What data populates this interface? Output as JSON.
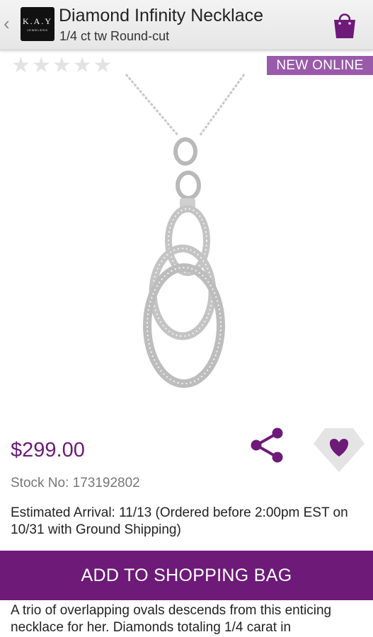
{
  "header": {
    "back_glyph": "‹",
    "logo": {
      "text": "K.A.Y",
      "subtext": "JEWELERS"
    },
    "title": "Diamond Infinity Necklace",
    "subtitle": "1/4 ct tw Round-cut",
    "bag_icon": "shopping-bag-icon"
  },
  "rating": {
    "stars_filled": 0,
    "stars_total": 5,
    "star_glyph": "★"
  },
  "badge": {
    "label": "NEW ONLINE"
  },
  "product": {
    "price": "$299.00",
    "stock": "Stock No: 173192802",
    "arrival": "Estimated Arrival: 11/13 (Ordered before 2:00pm EST on 10/31 with Ground Shipping)",
    "add_button": "ADD TO SHOPPING BAG",
    "description": "A trio of overlapping ovals descends from this enticing necklace for her. Diamonds totaling 1/4 carat in"
  },
  "icons": {
    "share": "share-icon",
    "wishlist": "heart-diamond-icon"
  },
  "colors": {
    "brand_purple": "#6d1a78",
    "price_purple": "#6a1c76",
    "badge_purple": "#9a5aaa",
    "star_empty": "#e3e3e3"
  }
}
